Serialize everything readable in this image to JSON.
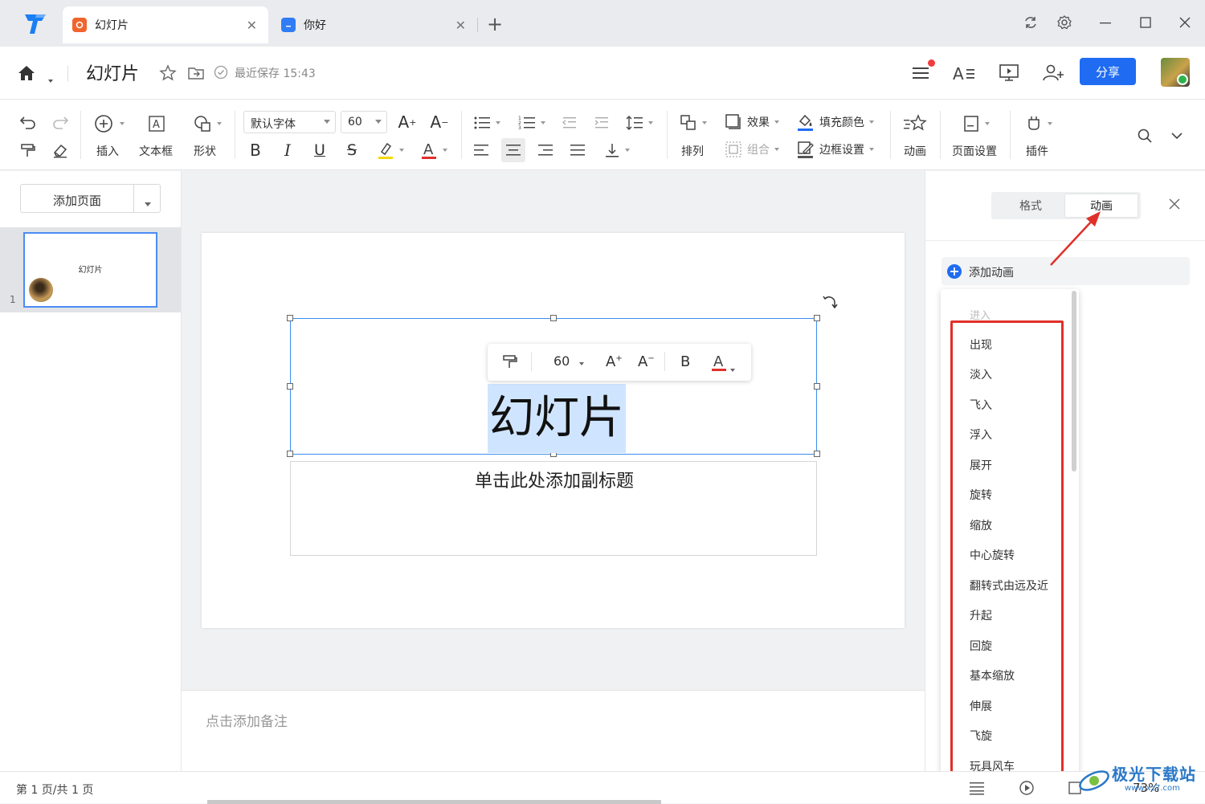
{
  "tabs": [
    {
      "label": "幻灯片",
      "active": true,
      "icon": "slides-icon",
      "color": "#f0642d"
    },
    {
      "label": "你好",
      "active": false,
      "icon": "doc-icon",
      "color": "#2f7cf6"
    }
  ],
  "header": {
    "doc_title": "幻灯片",
    "save_status": "最近保存 15:43",
    "share_label": "分享"
  },
  "toolbar": {
    "insert_label": "插入",
    "textbox_label": "文本框",
    "shape_label": "形状",
    "font_family": "默认字体",
    "font_size": "60",
    "arrange_label": "排列",
    "effect_label": "效果",
    "group_label": "组合",
    "fill_color_label": "填充颜色",
    "border_label": "边框设置",
    "animation_label": "动画",
    "page_setup_label": "页面设置",
    "plugin_label": "插件"
  },
  "left_panel": {
    "add_page_label": "添加页面",
    "thumbnails": [
      {
        "number": "1",
        "title": "幻灯片"
      }
    ]
  },
  "slide": {
    "title": "幻灯片",
    "subtitle": "单击此处添加副标题",
    "float_toolbar": {
      "font_size": "60"
    }
  },
  "notes_placeholder": "点击添加备注",
  "right_panel": {
    "tabs": [
      {
        "label": "格式",
        "active": false
      },
      {
        "label": "动画",
        "active": true
      }
    ],
    "add_animation_label": "添加动画",
    "dropdown_header": "进入",
    "animations": [
      "出现",
      "淡入",
      "飞入",
      "浮入",
      "展开",
      "旋转",
      "缩放",
      "中心旋转",
      "翻转式由远及近",
      "升起",
      "回旋",
      "基本缩放",
      "伸展",
      "飞旋",
      "玩具风车"
    ]
  },
  "status": {
    "page_info": "第 1 页/共 1 页",
    "zoom": "73%"
  },
  "watermark": {
    "text": "极光下载站",
    "url": "www.xz7.com"
  },
  "colors": {
    "accent": "#1f6cf2",
    "highlight": "#e0302a",
    "selection": "#cfe5ff"
  }
}
